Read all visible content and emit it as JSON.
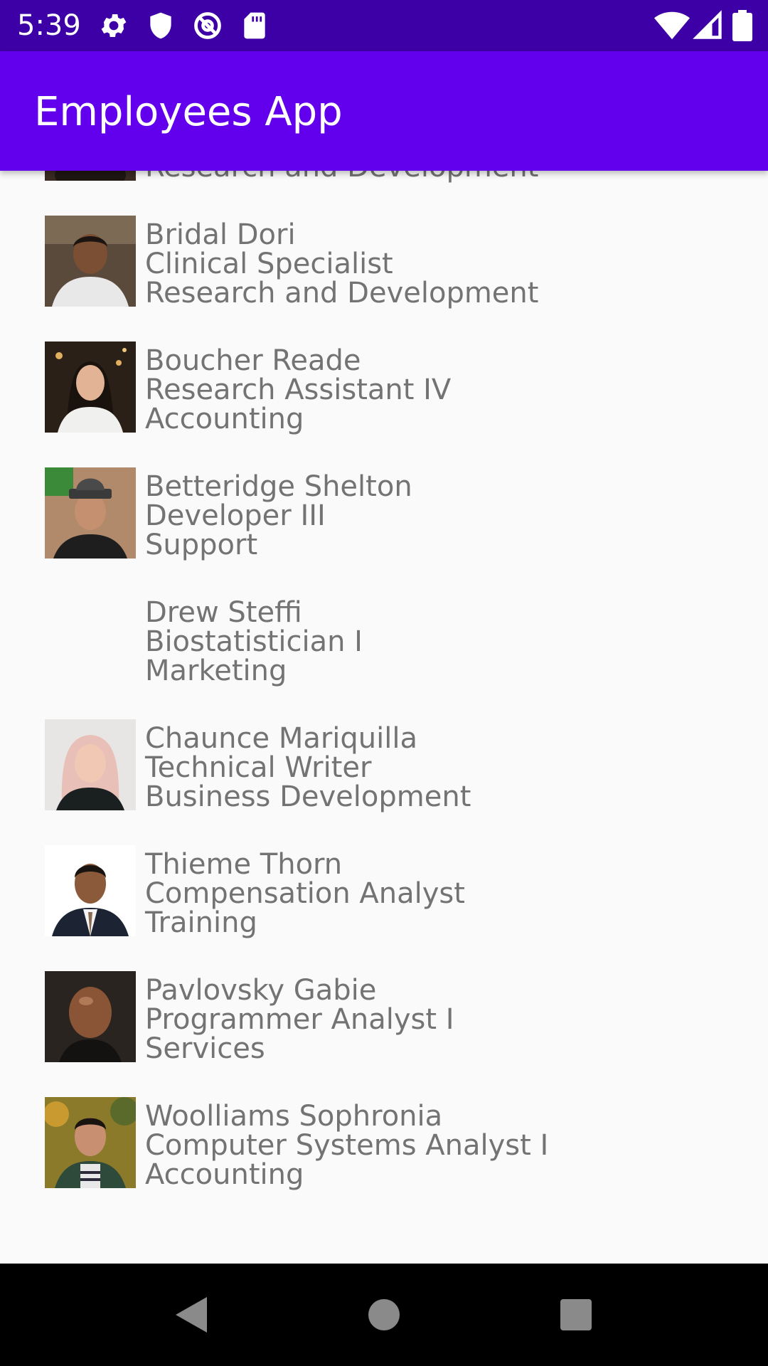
{
  "status_bar": {
    "time": "5:39",
    "left_icons": [
      "settings-icon",
      "shield-icon",
      "at-sign-icon",
      "sd-card-icon"
    ],
    "right_icons": [
      "wifi-icon",
      "signal-icon",
      "battery-icon"
    ]
  },
  "app_bar": {
    "title": "Employees App"
  },
  "employees": [
    {
      "name": "",
      "title": "",
      "department": "Research and Development",
      "has_photo": true
    },
    {
      "name": "Bridal Dori",
      "title": "Clinical Specialist",
      "department": "Research and Development",
      "has_photo": true
    },
    {
      "name": "Boucher Reade",
      "title": "Research Assistant IV",
      "department": "Accounting",
      "has_photo": true
    },
    {
      "name": "Betteridge Shelton",
      "title": "Developer III",
      "department": "Support",
      "has_photo": true
    },
    {
      "name": "Drew Steffi",
      "title": "Biostatistician I",
      "department": "Marketing",
      "has_photo": false
    },
    {
      "name": "Chaunce Mariquilla",
      "title": "Technical Writer",
      "department": "Business Development",
      "has_photo": true
    },
    {
      "name": "Thieme Thorn",
      "title": "Compensation Analyst",
      "department": "Training",
      "has_photo": true
    },
    {
      "name": "Pavlovsky Gabie",
      "title": "Programmer Analyst I",
      "department": "Services",
      "has_photo": true
    },
    {
      "name": "Woolliams Sophronia",
      "title": "Computer Systems Analyst I",
      "department": "Accounting",
      "has_photo": true
    }
  ],
  "nav_bar": {
    "buttons": [
      "back-icon",
      "home-icon",
      "recents-icon"
    ]
  },
  "colors": {
    "status_bar": "#3d00a6",
    "app_bar": "#6200ee",
    "background": "#fafafa",
    "text": "#737373",
    "nav_bar": "#000000"
  }
}
